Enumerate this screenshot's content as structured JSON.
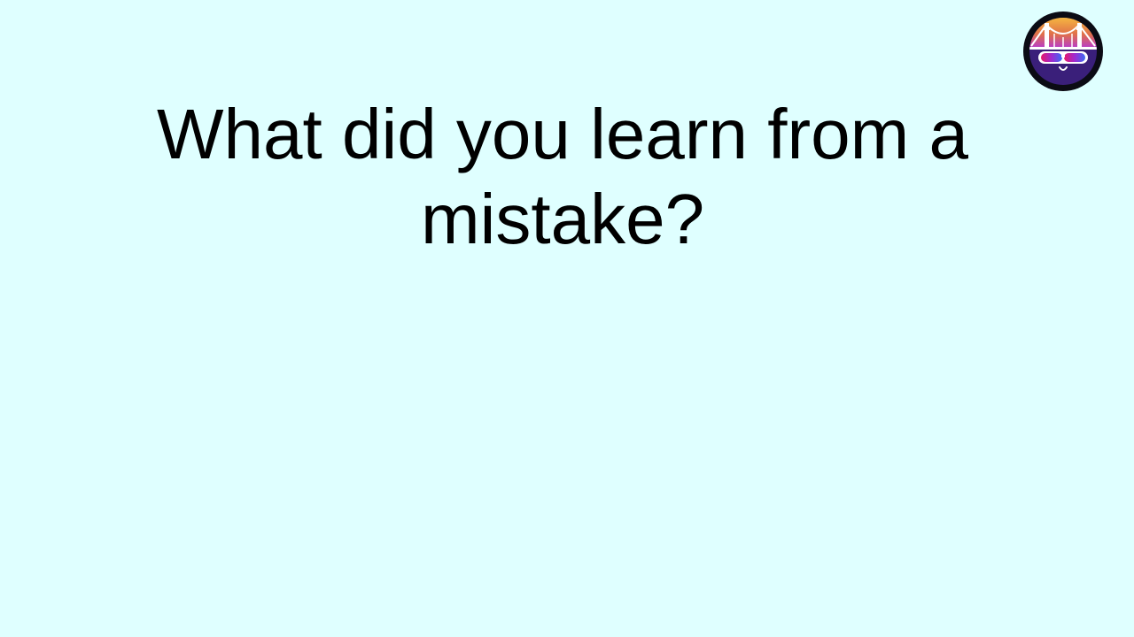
{
  "slide": {
    "background_color": "#dfffff",
    "question_text": "What did you learn from a mistake?",
    "text_color": "#000000"
  },
  "logo": {
    "icon": "bridge-sunglasses-face-logo",
    "ring_color": "#0b0b14",
    "face_color": "#3a1f7a",
    "sky_top_color": "#f5b640",
    "sky_bottom_color": "#b83cc9",
    "lens_left_color": "#e6186a",
    "lens_right_color": "#3b6cf5"
  }
}
